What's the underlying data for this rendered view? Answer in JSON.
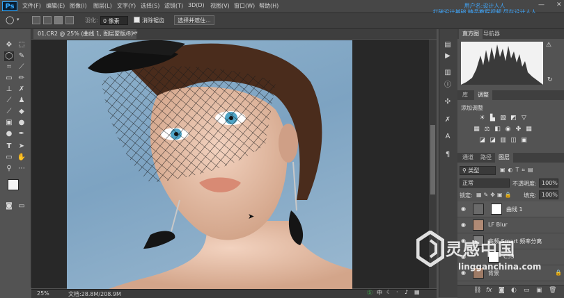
{
  "app": {
    "logo": "Ps"
  },
  "menu": [
    "文件(F)",
    "编辑(E)",
    "图像(I)",
    "图层(L)",
    "文字(Y)",
    "选择(S)",
    "滤镜(T)",
    "3D(D)",
    "视图(V)",
    "窗口(W)",
    "帮助(H)"
  ],
  "promo_overlay": {
    "line1": "用户名:设计人人",
    "line2": "打破设计基础 精品教程视频 尽在设计人人"
  },
  "options": {
    "feather_label": "羽化:",
    "feather_value": "0 像素",
    "antialias_label": "消除锯齿",
    "select_mask_button": "选择并遮住..."
  },
  "document": {
    "tab_title": "01.CR2 @ 25% (曲线 1, 图层蒙版/8) *",
    "zoom": "25%",
    "doc_size": "文档:28.8M/208.9M"
  },
  "panels": {
    "histogram_tabs": [
      "直方图",
      "导航器"
    ],
    "adjust_tabs": [
      "库",
      "调整"
    ],
    "adjust_heading": "添加调整",
    "layers_tabs": [
      "通道",
      "路径",
      "图层"
    ],
    "filter_kind": "类型",
    "blend_mode": "正常",
    "opacity_label": "不透明度:",
    "opacity_value": "100%",
    "lock_label": "锁定:",
    "fill_label": "填充:",
    "fill_value": "100%",
    "layers": [
      {
        "name": "曲线 1",
        "thumb": "#ffffff"
      },
      {
        "name": "LF Blur",
        "thumb": "#b08a75"
      },
      {
        "name": "高频 Smart 频率分离",
        "thumb": "#7d7d7d"
      },
      {
        "name": "C53",
        "thumb": "#ffffff"
      },
      {
        "name": "背景",
        "thumb": "#9e7b66"
      }
    ]
  },
  "watermark": {
    "brand": "灵感中国",
    "url": "lingganchina.com"
  },
  "colors": {
    "accent": "#31a8ff",
    "panel_bg": "#535353",
    "canvas_bg": "#282828"
  }
}
